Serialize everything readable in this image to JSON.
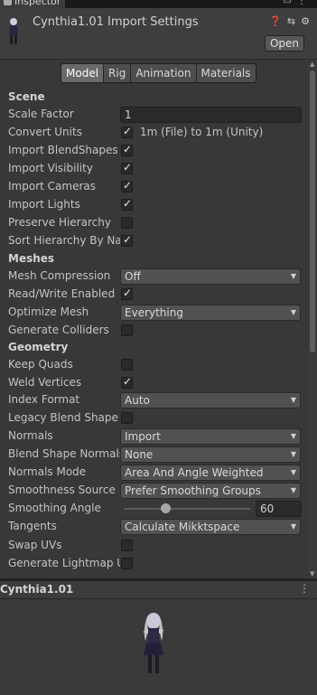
{
  "window": {
    "tab_label": "Inspector",
    "title": "Cynthia1.01 Import Settings",
    "open_button": "Open"
  },
  "subtabs": [
    {
      "label": "Model",
      "active": true
    },
    {
      "label": "Rig",
      "active": false
    },
    {
      "label": "Animation",
      "active": false
    },
    {
      "label": "Materials",
      "active": false
    }
  ],
  "scene": {
    "heading": "Scene",
    "scale_factor": {
      "label": "Scale Factor",
      "value": "1"
    },
    "convert_units": {
      "label": "Convert Units",
      "checked": true,
      "note": "1m (File) to 1m (Unity)"
    },
    "import_blendshapes": {
      "label": "Import BlendShapes",
      "checked": true
    },
    "import_visibility": {
      "label": "Import Visibility",
      "checked": true
    },
    "import_cameras": {
      "label": "Import Cameras",
      "checked": true
    },
    "import_lights": {
      "label": "Import Lights",
      "checked": true
    },
    "preserve_hierarchy": {
      "label": "Preserve Hierarchy",
      "checked": false
    },
    "sort_hierarchy": {
      "label": "Sort Hierarchy By Nar",
      "checked": true
    }
  },
  "meshes": {
    "heading": "Meshes",
    "mesh_compression": {
      "label": "Mesh Compression",
      "value": "Off"
    },
    "read_write": {
      "label": "Read/Write Enabled",
      "checked": true
    },
    "optimize_mesh": {
      "label": "Optimize Mesh",
      "value": "Everything"
    },
    "generate_colliders": {
      "label": "Generate Colliders",
      "checked": false
    }
  },
  "geometry": {
    "heading": "Geometry",
    "keep_quads": {
      "label": "Keep Quads",
      "checked": false
    },
    "weld_vertices": {
      "label": "Weld Vertices",
      "checked": true
    },
    "index_format": {
      "label": "Index Format",
      "value": "Auto"
    },
    "legacy_blend": {
      "label": "Legacy Blend Shape N",
      "checked": false
    },
    "normals": {
      "label": "Normals",
      "value": "Import"
    },
    "blend_normals": {
      "label": "Blend Shape Normals",
      "value": "None"
    },
    "normals_mode": {
      "label": "Normals Mode",
      "value": "Area And Angle Weighted"
    },
    "smoothness_source": {
      "label": "Smoothness Source",
      "value": "Prefer Smoothing Groups"
    },
    "smoothing_angle": {
      "label": "Smoothing Angle",
      "value": "60",
      "fraction": 0.333
    },
    "tangents": {
      "label": "Tangents",
      "value": "Calculate Mikktspace"
    },
    "swap_uvs": {
      "label": "Swap UVs",
      "checked": false
    },
    "gen_lightmap_uvs": {
      "label": "Generate Lightmap UV",
      "checked": false
    }
  },
  "preview": {
    "title": "Cynthia1.01",
    "menu_icon": "kebab-menu-icon"
  }
}
